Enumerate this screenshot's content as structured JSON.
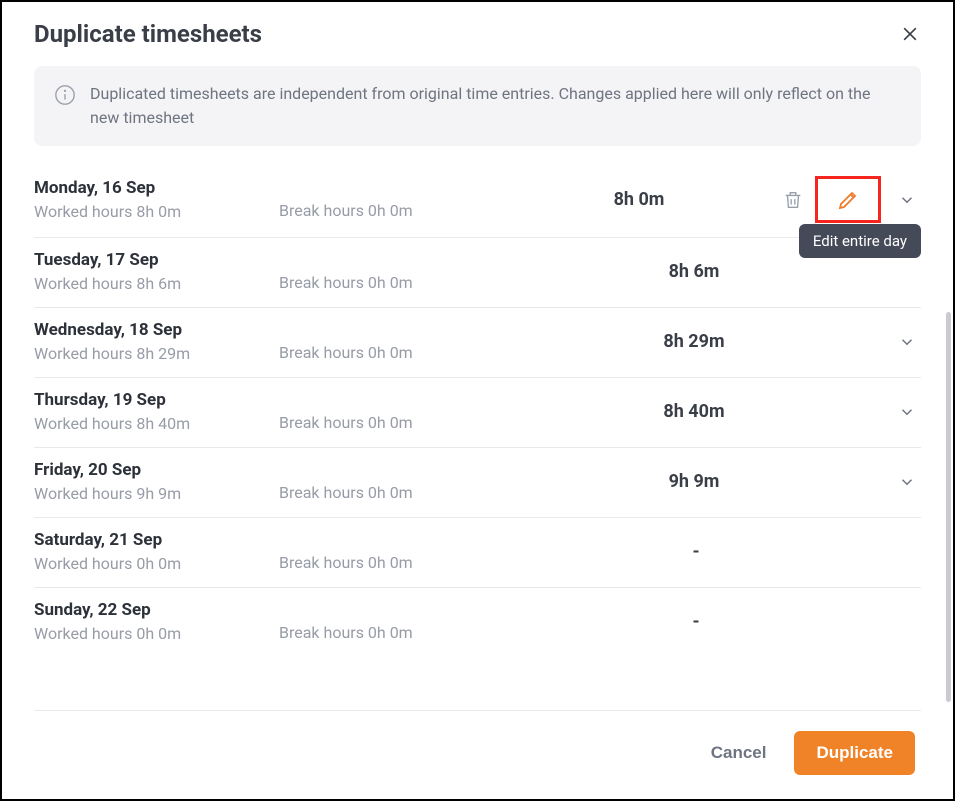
{
  "modal": {
    "title": "Duplicate timesheets",
    "info": "Duplicated timesheets are independent from original time entries. Changes applied here will only reflect on the new timesheet",
    "tooltip_edit": "Edit entire day"
  },
  "days": [
    {
      "name": "Monday, 16 Sep",
      "worked_label": "Worked hours 8h 0m",
      "break_label": "Break hours 0h 0m",
      "total": "8h 0m",
      "show_actions": true
    },
    {
      "name": "Tuesday, 17 Sep",
      "worked_label": "Worked hours 8h 6m",
      "break_label": "Break hours 0h 0m",
      "total": "8h 6m",
      "show_actions": false
    },
    {
      "name": "Wednesday, 18 Sep",
      "worked_label": "Worked hours 8h 29m",
      "break_label": "Break hours 0h 0m",
      "total": "8h 29m",
      "show_actions": false
    },
    {
      "name": "Thursday, 19 Sep",
      "worked_label": "Worked hours 8h 40m",
      "break_label": "Break hours 0h 0m",
      "total": "8h 40m",
      "show_actions": false
    },
    {
      "name": "Friday, 20 Sep",
      "worked_label": "Worked hours 9h 9m",
      "break_label": "Break hours 0h 0m",
      "total": "9h 9m",
      "show_actions": false
    },
    {
      "name": "Saturday, 21 Sep",
      "worked_label": "Worked hours 0h 0m",
      "break_label": "Break hours 0h 0m",
      "total": "-",
      "show_actions": false,
      "no_chevron": true
    },
    {
      "name": "Sunday, 22 Sep",
      "worked_label": "Worked hours 0h 0m",
      "break_label": "Break hours 0h 0m",
      "total": "-",
      "show_actions": false,
      "no_chevron": true
    }
  ],
  "footer": {
    "cancel": "Cancel",
    "duplicate": "Duplicate"
  }
}
